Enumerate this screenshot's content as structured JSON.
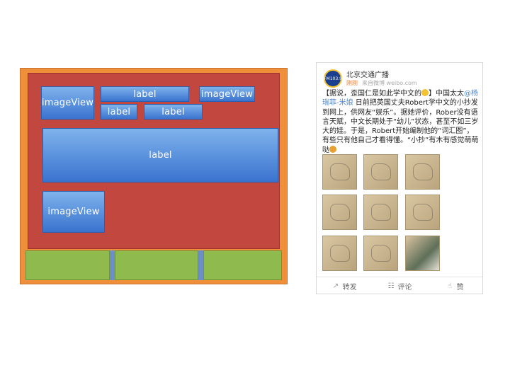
{
  "mockup": {
    "top_image_view": "imageView",
    "label_top": "label",
    "right_image_view": "imageView",
    "label_small_1": "label",
    "label_small_2": "label",
    "label_big": "label",
    "bottom_image_view": "imageView"
  },
  "colors": {
    "outer": "#f08f3a",
    "inner": "#c2473f",
    "blue": "#3a73cf",
    "green": "#8fba4d"
  },
  "weibo": {
    "account": "北京交通广播",
    "logo_text": "FM103.9",
    "time": "刚刚",
    "source": "来自微博 weibo.com",
    "text_1": "【据说，歪国仁是如此学中文的",
    "text_2": "】中国太太",
    "mention_at": "@",
    "mention_name": "杨瑞菲-米娘",
    "text_3": " 日前把英国丈夫Robert学中文的小抄发到网上，供网友“娱乐”。据她评价，Rober没有语言天赋，中文长期处于“幼儿”状态，甚至不如三岁大的娃。于是，Robert开始编制他的“词汇图”，有些只有他自己才看得懂。“小抄”有木有感觉萌萌哒",
    "actions": {
      "repost": "转发",
      "comment": "评论",
      "like": "赞"
    },
    "icons": [
      "repost-icon",
      "comment-icon",
      "like-icon"
    ]
  }
}
